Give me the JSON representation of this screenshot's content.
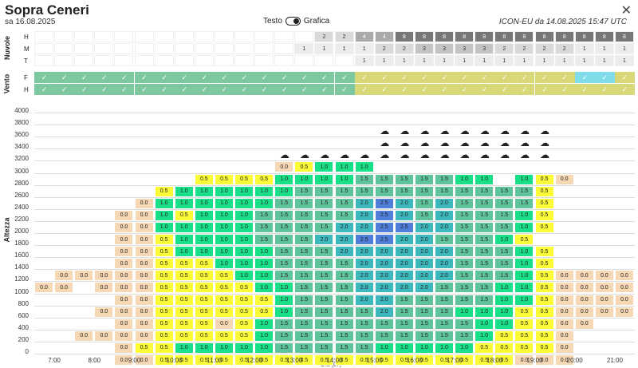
{
  "header": {
    "title": "Sopra Ceneri",
    "date": "sa 16.08.2025",
    "toggle_left": "Testo",
    "toggle_right": "Grafica",
    "model": "ICON-EU da 14.08.2025 15:47 UTC"
  },
  "labels": {
    "nuvole": "Nuvole",
    "vento": "Vento",
    "altezza": "Altezza",
    "ora": "Ora (LT)"
  },
  "cloud_rows": [
    "H",
    "M",
    "T"
  ],
  "wind_rows": [
    "F",
    "H"
  ],
  "times": [
    "7:00",
    "8:00",
    "9:00",
    "10:00",
    "11:00",
    "12:00",
    "13:00",
    "14:00",
    "15:00",
    "16:00",
    "17:00",
    "18:00",
    "19:00",
    "20:00",
    "21:00"
  ],
  "alt_ticks": [
    "4000",
    "3800",
    "3600",
    "3400",
    "3200",
    "3000",
    "2800",
    "2600",
    "2400",
    "2200",
    "2000",
    "1800",
    "1600",
    "1400",
    "1200",
    "1000",
    "800",
    "600",
    "400",
    "200",
    "0"
  ],
  "clouds": {
    "H": [
      "",
      "",
      "",
      "",
      "",
      "",
      "",
      "",
      "",
      "",
      "",
      "",
      "",
      "",
      "2",
      "2",
      "4",
      "4",
      "8",
      "8",
      "8",
      "8",
      "8",
      "8",
      "8",
      "8",
      "8",
      "8",
      "8",
      "8"
    ],
    "M": [
      "",
      "",
      "",
      "",
      "",
      "",
      "",
      "",
      "",
      "",
      "",
      "",
      "",
      "1",
      "1",
      "1",
      "1",
      "2",
      "2",
      "3",
      "3",
      "3",
      "3",
      "2",
      "2",
      "2",
      "2",
      "1",
      "1",
      "1"
    ],
    "T": [
      "",
      "",
      "",
      "",
      "",
      "",
      "",
      "",
      "",
      "",
      "",
      "",
      "",
      "",
      "",
      "",
      "1",
      "1",
      "1",
      "1",
      "1",
      "1",
      "1",
      "1",
      "1",
      "1",
      "1",
      "1",
      "1",
      "1"
    ]
  },
  "colors": {
    "c00": "#f6d8b4",
    "c05": "#fbfb38",
    "c10": "#19e088",
    "c15": "#5fc39c",
    "c20": "#3db9be",
    "c25": "#4f7fd8",
    "wind_green": "#7ec8a0",
    "wind_yellow": "#d8d878",
    "wind_cyan": "#7fdce8"
  },
  "grid": [
    {
      "alt": "4000",
      "v": [
        "",
        "",
        "",
        "",
        "",
        "",
        "",
        "",
        "",
        "",
        "",
        "",
        "",
        "",
        "",
        "",
        "",
        "",
        "",
        "",
        "",
        "",
        "",
        "",
        "",
        "",
        "",
        "",
        "",
        ""
      ]
    },
    {
      "alt": "3800",
      "v": [
        "",
        "",
        "",
        "",
        "",
        "",
        "",
        "",
        "",
        "",
        "",
        "",
        "",
        "",
        "",
        "",
        "",
        "",
        "",
        "",
        "",
        "",
        "",
        "",
        "",
        "",
        "",
        "",
        "",
        ""
      ]
    },
    {
      "alt": "3600",
      "v": [
        "",
        "",
        "",
        "",
        "",
        "",
        "",
        "",
        "",
        "",
        "",
        "",
        "",
        "",
        "",
        "",
        "",
        "",
        "",
        "",
        "",
        "",
        "",
        "",
        "",
        "",
        "",
        "",
        "",
        ""
      ]
    },
    {
      "alt": "3400",
      "v": [
        "",
        "",
        "",
        "",
        "",
        "",
        "",
        "",
        "",
        "",
        "",
        "",
        "",
        "",
        "",
        "",
        "",
        "",
        "",
        "",
        "",
        "",
        "",
        "",
        "",
        "",
        "",
        "",
        "",
        ""
      ]
    },
    {
      "alt": "3200",
      "v": [
        "",
        "",
        "",
        "",
        "",
        "",
        "",
        "",
        "",
        "",
        "",
        "",
        "0.0",
        "0.5",
        "1.0",
        "1.0",
        "1.0",
        "",
        "",
        "",
        "",
        "",
        "",
        "",
        "",
        "",
        "",
        "",
        "",
        ""
      ]
    },
    {
      "alt": "3000",
      "v": [
        "",
        "",
        "",
        "",
        "",
        "",
        "",
        "",
        "0.5",
        "0.5",
        "0.5",
        "0.5",
        "1.0",
        "1.0",
        "1.0",
        "1.0",
        "1.5",
        "1.5",
        "1.5",
        "1.5",
        "1.5",
        "1.0",
        "1.0",
        "",
        "1.0",
        "0.5",
        "0.0",
        "",
        "",
        ""
      ]
    },
    {
      "alt": "2800",
      "v": [
        "",
        "",
        "",
        "",
        "",
        "",
        "0.5",
        "1.0",
        "1.0",
        "1.0",
        "1.0",
        "1.0",
        "1.0",
        "1.5",
        "1.5",
        "1.5",
        "1.5",
        "1.5",
        "1.5",
        "1.5",
        "1.5",
        "1.5",
        "1.5",
        "1.5",
        "1.5",
        "0.5",
        "",
        "",
        "",
        ""
      ]
    },
    {
      "alt": "2600",
      "v": [
        "",
        "",
        "",
        "",
        "",
        "0.0",
        "1.0",
        "1.0",
        "1.0",
        "1.0",
        "1.0",
        "1.0",
        "1.5",
        "1.5",
        "1.5",
        "1.5",
        "2.0",
        "2.5",
        "2.0",
        "1.5",
        "2.0",
        "1.5",
        "1.5",
        "1.5",
        "1.5",
        "0.5",
        "",
        "",
        "",
        ""
      ]
    },
    {
      "alt": "2400",
      "v": [
        "",
        "",
        "",
        "",
        "0.0",
        "0.0",
        "1.0",
        "0.5",
        "1.0",
        "1.0",
        "1.0",
        "1.5",
        "1.5",
        "1.5",
        "1.5",
        "1.5",
        "2.0",
        "2.5",
        "2.0",
        "1.5",
        "2.0",
        "1.5",
        "1.5",
        "1.5",
        "1.0",
        "0.5",
        "",
        "",
        "",
        ""
      ]
    },
    {
      "alt": "2200",
      "v": [
        "",
        "",
        "",
        "",
        "0.0",
        "0.0",
        "1.0",
        "1.0",
        "1.0",
        "1.0",
        "1.0",
        "1.5",
        "1.5",
        "1.5",
        "1.5",
        "2.0",
        "2.0",
        "2.5",
        "2.5",
        "2.0",
        "2.0",
        "1.5",
        "1.5",
        "1.5",
        "1.0",
        "0.5",
        "",
        "",
        "",
        ""
      ]
    },
    {
      "alt": "2000",
      "v": [
        "",
        "",
        "",
        "",
        "0.0",
        "0.0",
        "0.5",
        "1.0",
        "1.0",
        "1.0",
        "1.0",
        "1.5",
        "1.5",
        "1.5",
        "2.0",
        "2.0",
        "2.5",
        "2.5",
        "2.0",
        "2.0",
        "1.5",
        "1.5",
        "1.5",
        "1.0",
        "0.5",
        "",
        "",
        "",
        ""
      ]
    },
    {
      "alt": "1800",
      "v": [
        "",
        "",
        "",
        "",
        "0.0",
        "0.0",
        "0.5",
        "1.0",
        "1.0",
        "1.0",
        "1.0",
        "1.0",
        "1.5",
        "1.5",
        "1.5",
        "2.0",
        "2.0",
        "2.0",
        "2.0",
        "2.0",
        "2.0",
        "1.5",
        "1.5",
        "1.5",
        "1.0",
        "0.5",
        "",
        "",
        "",
        ""
      ]
    },
    {
      "alt": "1600",
      "v": [
        "",
        "",
        "",
        "",
        "0.0",
        "0.0",
        "0.5",
        "0.5",
        "0.5",
        "1.0",
        "1.0",
        "1.0",
        "1.5",
        "1.5",
        "1.5",
        "1.5",
        "2.0",
        "2.0",
        "2.0",
        "2.0",
        "2.0",
        "1.5",
        "1.5",
        "1.5",
        "1.0",
        "0.5",
        "",
        "",
        "",
        ""
      ]
    },
    {
      "alt": "1400",
      "v": [
        "",
        "0.0",
        "0.0",
        "0.0",
        "0.0",
        "0.0",
        "0.5",
        "0.5",
        "0.5",
        "0.5",
        "1.0",
        "1.0",
        "1.5",
        "1.5",
        "1.5",
        "1.5",
        "2.0",
        "2.0",
        "2.0",
        "2.0",
        "2.0",
        "1.5",
        "1.5",
        "1.5",
        "1.0",
        "0.5",
        "0.0",
        "0.0",
        "0.0",
        "0.0"
      ]
    },
    {
      "alt": "1200",
      "v": [
        "0.0",
        "0.0",
        "",
        "0.0",
        "0.0",
        "0.0",
        "0.5",
        "0.5",
        "0.5",
        "0.5",
        "0.5",
        "1.0",
        "1.0",
        "1.5",
        "1.5",
        "1.5",
        "2.0",
        "2.0",
        "2.0",
        "2.0",
        "1.5",
        "1.5",
        "1.5",
        "1.0",
        "1.0",
        "0.5",
        "0.0",
        "0.0",
        "0.0",
        "0.0"
      ]
    },
    {
      "alt": "1000",
      "v": [
        "",
        "",
        "",
        "",
        "0.0",
        "0.0",
        "0.5",
        "0.5",
        "0.5",
        "0.5",
        "0.5",
        "0.5",
        "1.0",
        "1.5",
        "1.5",
        "1.5",
        "2.0",
        "2.0",
        "1.5",
        "1.5",
        "1.5",
        "1.5",
        "1.5",
        "1.0",
        "1.0",
        "0.5",
        "0.0",
        "0.0",
        "0.0",
        "0.0"
      ]
    },
    {
      "alt": "800",
      "v": [
        "",
        "",
        "",
        "0.0",
        "0.0",
        "0.0",
        "0.5",
        "0.5",
        "0.5",
        "0.5",
        "0.5",
        "0.5",
        "1.0",
        "1.5",
        "1.5",
        "1.5",
        "1.5",
        "2.0",
        "1.5",
        "1.5",
        "1.5",
        "1.0",
        "1.0",
        "1.0",
        "0.5",
        "0.5",
        "0.0",
        "0.0",
        "0.0",
        "0.0"
      ]
    },
    {
      "alt": "600",
      "v": [
        "",
        "",
        "",
        "",
        "0.0",
        "0.0",
        "0.5",
        "0.5",
        "0.5",
        "0.0",
        "0.5",
        "1.0",
        "1.5",
        "1.5",
        "1.5",
        "1.5",
        "1.5",
        "1.5",
        "1.5",
        "1.5",
        "1.5",
        "1.5",
        "1.0",
        "1.0",
        "0.5",
        "0.5",
        "0.0",
        "0.0",
        "",
        ""
      ]
    },
    {
      "alt": "400",
      "v": [
        "",
        "",
        "0.0",
        "0.0",
        "0.0",
        "0.0",
        "0.5",
        "0.5",
        "0.5",
        "0.5",
        "0.5",
        "1.0",
        "1.5",
        "1.5",
        "1.5",
        "1.5",
        "1.5",
        "1.5",
        "1.5",
        "1.5",
        "1.5",
        "1.5",
        "1.0",
        "0.5",
        "0.5",
        "0.5",
        "0.0",
        "",
        "",
        ""
      ]
    },
    {
      "alt": "200",
      "v": [
        "",
        "",
        "",
        "",
        "0.0",
        "0.5",
        "0.5",
        "1.0",
        "1.0",
        "1.0",
        "1.0",
        "1.0",
        "1.5",
        "1.5",
        "1.5",
        "1.5",
        "1.5",
        "1.0",
        "1.0",
        "1.0",
        "1.0",
        "1.0",
        "0.5",
        "0.5",
        "0.5",
        "0.5",
        "0.0",
        "",
        "",
        ""
      ]
    },
    {
      "alt": "0",
      "v": [
        "",
        "",
        "",
        "",
        "0.0",
        "0.0",
        "0.5",
        "0.5",
        "0.5",
        "0.5",
        "0.5",
        "0.5",
        "0.5",
        "0.5",
        "0.5",
        "0.5",
        "0.5",
        "0.5",
        "0.5",
        "0.5",
        "0.5",
        "0.5",
        "0.5",
        "0.5",
        "0.0",
        "0.0",
        "0.0",
        "",
        "",
        ""
      ]
    }
  ]
}
